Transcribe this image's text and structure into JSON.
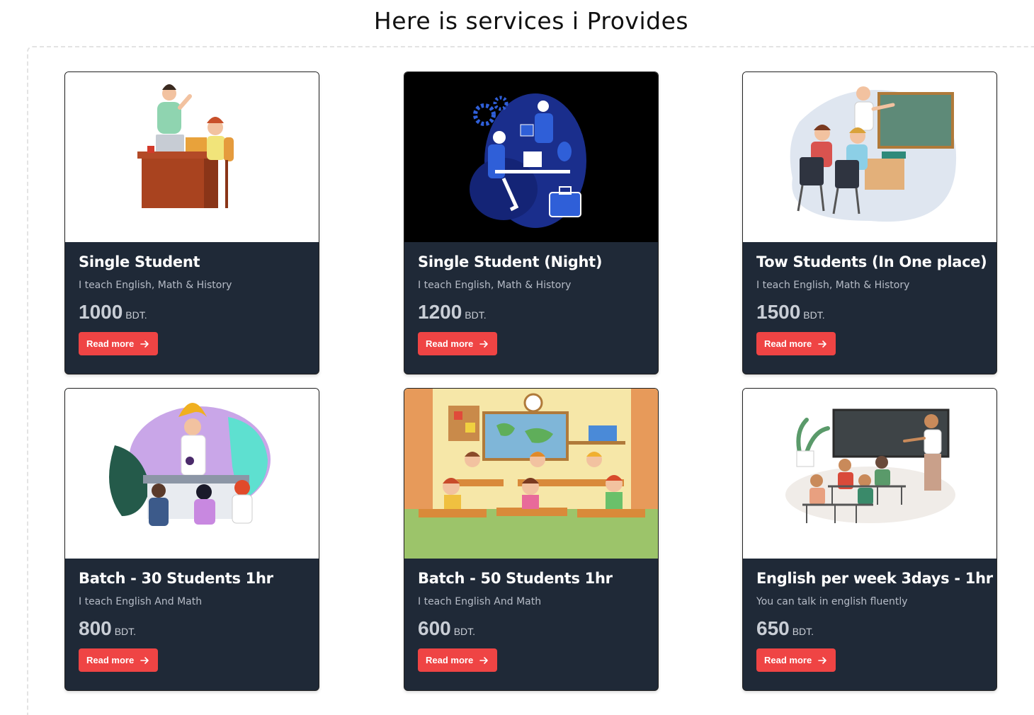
{
  "page": {
    "title": "Here is services i Provides"
  },
  "cards": [
    {
      "title": "Single Student",
      "desc": "I teach English, Math & History",
      "price": "1000",
      "unit": "BDT.",
      "button": "Read more",
      "image": "tutor-with-student-illustration"
    },
    {
      "title": "Single Student (Night)",
      "desc": "I teach English, Math & History",
      "price": "1200",
      "unit": "BDT.",
      "button": "Read more",
      "image": "night-study-illustration"
    },
    {
      "title": "Tow Students (In One place)",
      "desc": "I teach English, Math & History",
      "price": "1500",
      "unit": "BDT.",
      "button": "Read more",
      "image": "classroom-two-students-illustration"
    },
    {
      "title": "Batch - 30 Students 1hr",
      "desc": "I teach English And Math",
      "price": "800",
      "unit": "BDT.",
      "button": "Read more",
      "image": "science-teacher-batch-illustration"
    },
    {
      "title": "Batch - 50 Students 1hr",
      "desc": "I teach English And Math",
      "price": "600",
      "unit": "BDT.",
      "button": "Read more",
      "image": "kids-classroom-illustration"
    },
    {
      "title": "English per week 3days - 1hr",
      "desc": "You can talk in english fluently",
      "price": "650",
      "unit": "BDT.",
      "button": "Read more",
      "image": "english-class-blackboard-illustration"
    }
  ],
  "colors": {
    "card_bg": "#1f2937",
    "button": "#ef4444",
    "title": "#ffffff"
  }
}
